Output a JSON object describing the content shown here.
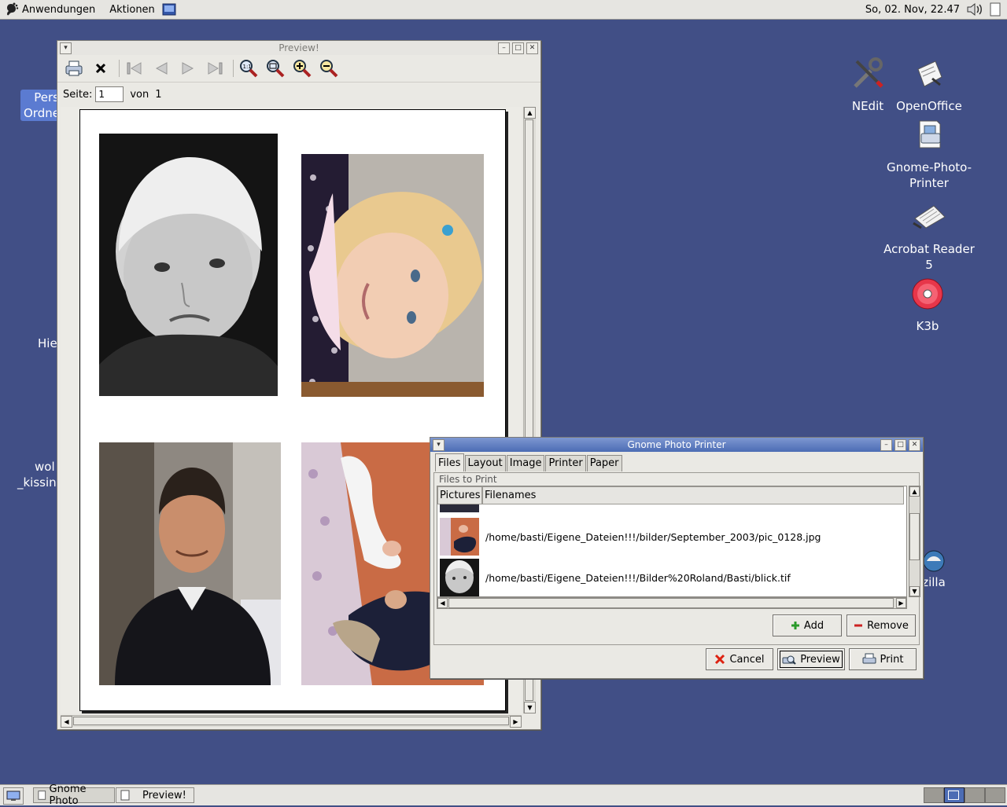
{
  "top_panel": {
    "menus": [
      "Anwendungen",
      "Aktionen"
    ],
    "clock": "So, 02. Nov, 22.47"
  },
  "desktop_icons": [
    {
      "label": "NEdit",
      "icon": "wrench-screwdriver-icon"
    },
    {
      "label": "OpenOffice",
      "icon": "openoffice-icon"
    },
    {
      "label": "Gnome-Photo-Printer",
      "icon": "photo-printer-icon"
    },
    {
      "label": "Acrobat Reader 5",
      "icon": "acrobat-reader-icon"
    },
    {
      "label": "K3b",
      "icon": "cd-burner-icon"
    }
  ],
  "desktop_partial": {
    "selected_line1": "Pers",
    "selected_line2": "Ordne",
    "hie": "Hie",
    "wol": "wol",
    "kissin": "_kissin",
    "zilla": "zilla"
  },
  "preview_window": {
    "title": "Preview!",
    "page_label": "Seite:",
    "page_value": "1",
    "of_label": "von",
    "total_pages": "1",
    "toolbar_icons": [
      "print-icon",
      "close-icon",
      "first-page-icon",
      "prev-page-icon",
      "next-page-icon",
      "last-page-icon",
      "zoom-fit-icon",
      "zoom-100-icon",
      "zoom-in-icon",
      "zoom-out-icon"
    ]
  },
  "gpp_window": {
    "title": "Gnome Photo Printer",
    "tabs": [
      "Files",
      "Layout",
      "Image",
      "Printer",
      "Paper"
    ],
    "active_tab": "Files",
    "frame_label": "Files to Print",
    "columns": [
      "Pictures",
      "Filenames"
    ],
    "files": [
      "/home/basti/Eigene_Dateien!!!/bilder/September_2003/pic_0128.jpg",
      "/home/basti/Eigene_Dateien!!!/Bilder%20Roland/Basti/blick.tif"
    ],
    "buttons": {
      "add": "Add",
      "remove": "Remove",
      "cancel": "Cancel",
      "preview": "Preview",
      "print": "Print"
    }
  },
  "taskbar": {
    "tasks": [
      "Gnome Photo",
      "Preview!"
    ]
  },
  "colors": {
    "desktop": "#414f86",
    "title_active": "#4c6cb4",
    "panel": "#e6e5e1"
  }
}
